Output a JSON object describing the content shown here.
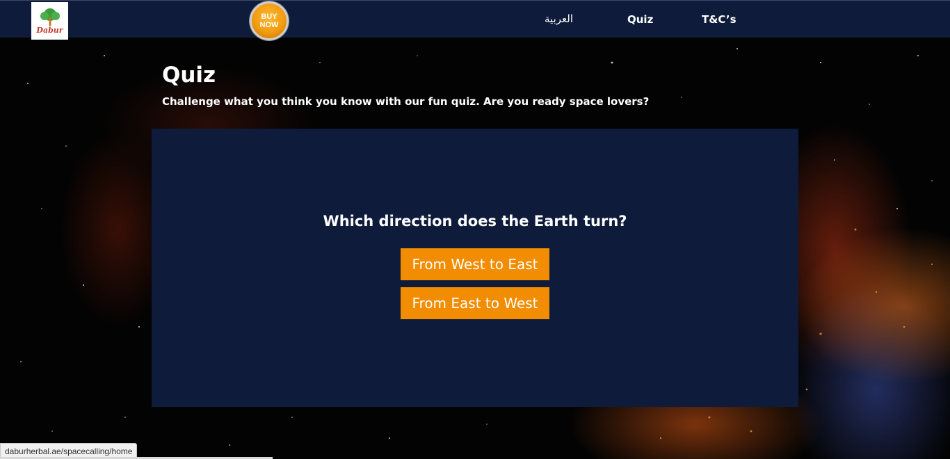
{
  "header": {
    "logo_text": "Dabur",
    "buy_now_line1": "BUY",
    "buy_now_line2": "NOW",
    "nav": {
      "arabic_label": "العربية",
      "quiz_label": "Quiz",
      "tc_label": "T&C’s"
    }
  },
  "page": {
    "title": "Quiz",
    "subtitle": "Challenge what you think you know with our fun quiz. Are you ready space lovers?"
  },
  "quiz": {
    "question": "Which direction does the Earth turn?",
    "answers": [
      "From West to East",
      "From East to West"
    ]
  },
  "status_bar": {
    "url": "daburherbal.ae/spacecalling/home"
  },
  "colors": {
    "nav_bg": "#0e1b3a",
    "panel_bg": "#0e1b3a",
    "answer_bg": "#f28c00",
    "buy_now": "#f39c12"
  }
}
